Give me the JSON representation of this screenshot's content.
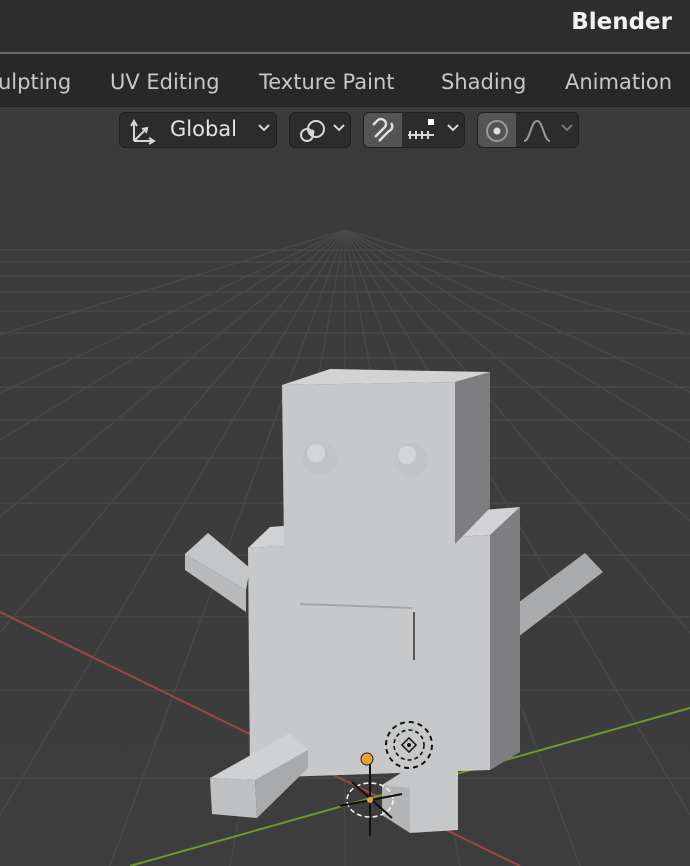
{
  "app": {
    "title": "Blender"
  },
  "workspace_tabs": [
    {
      "label": "ulpting"
    },
    {
      "label": "UV Editing"
    },
    {
      "label": "Texture Paint"
    },
    {
      "label": "Shading"
    },
    {
      "label": "Animation"
    }
  ],
  "viewport_header": {
    "transform_orientation": {
      "icon": "transform-orientation-icon",
      "value": "Global"
    },
    "pivot_point": {
      "icon": "pivot-point-icon"
    },
    "snapping": {
      "icon": "snap-magnet-icon",
      "active": true,
      "increment_icon": "snap-increment-icon"
    },
    "proportional_editing": {
      "icon": "proportional-editing-icon",
      "falloff_icon": "falloff-curve-icon"
    }
  },
  "scene": {
    "object": "robot-mesh",
    "gizmos": [
      "3d-cursor",
      "object-origin",
      "light-empty"
    ],
    "colors": {
      "x_axis": "#b04a4a",
      "y_axis": "#6c9a2e",
      "origin": "#f0a030"
    }
  }
}
